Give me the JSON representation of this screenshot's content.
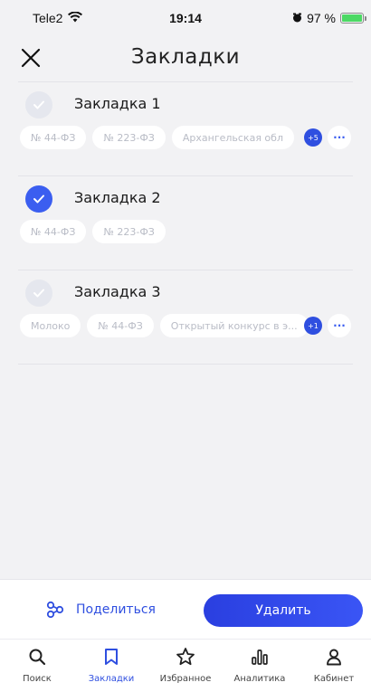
{
  "status_bar": {
    "carrier": "Tele2",
    "time": "19:14",
    "battery": "97 %"
  },
  "header": {
    "title": "Закладки"
  },
  "bookmarks": [
    {
      "name": "Закладка 1",
      "checked": false,
      "tags": [
        "№ 44-ФЗ",
        "№ 223-ФЗ",
        "Архангельская обл"
      ],
      "more_count": "+5"
    },
    {
      "name": "Закладка 2",
      "checked": true,
      "tags": [
        "№ 44-ФЗ",
        "№ 223-ФЗ"
      ],
      "more_count": ""
    },
    {
      "name": "Закладка 3",
      "checked": false,
      "tags": [
        "Молоко",
        "№ 44-ФЗ",
        "Открытый конкурс в э..."
      ],
      "more_count": "+1"
    }
  ],
  "actions": {
    "share_label": "Поделиться",
    "delete_label": "Удалить"
  },
  "tabs": [
    {
      "label": "Поиск",
      "icon": "search-icon",
      "active": false
    },
    {
      "label": "Закладки",
      "icon": "bookmark-icon",
      "active": true
    },
    {
      "label": "Избранное",
      "icon": "star-icon",
      "active": false
    },
    {
      "label": "Аналитика",
      "icon": "analytics-icon",
      "active": false
    },
    {
      "label": "Кабинет",
      "icon": "profile-icon",
      "active": false
    }
  ],
  "colors": {
    "accent": "#2f4fe0",
    "check_on": "#3b5ef0",
    "check_off": "#e5e7ee",
    "battery": "#4cd964"
  }
}
